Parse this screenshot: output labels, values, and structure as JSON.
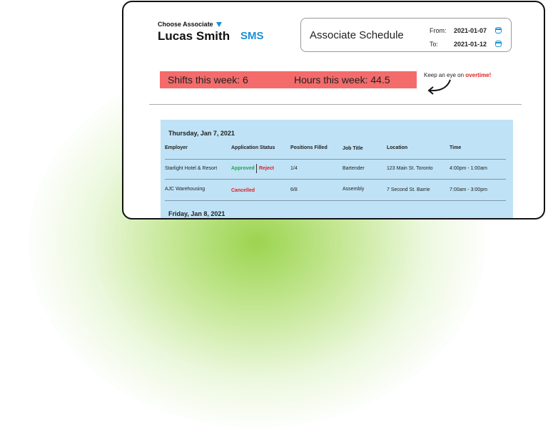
{
  "header": {
    "choose_label": "Choose Associate",
    "associate_name": "Lucas Smith",
    "brand": "SMS"
  },
  "schedule": {
    "title": "Associate Schedule",
    "from_label": "From:",
    "from_value": "2021-01-07",
    "to_label": "To:",
    "to_value": "2021-01-12"
  },
  "stats": {
    "shifts": "Shifts this week: 6",
    "hours": "Hours this week: 44.5"
  },
  "hint": {
    "prefix": "Keep an eye on ",
    "highlight": "overtime",
    "suffix": "!"
  },
  "table": {
    "columns": [
      "Employer",
      "Application Status",
      "Positions Filled",
      "Job Title",
      "Location",
      "Time"
    ],
    "days": [
      {
        "label": "Thursday, Jan 7, 2021",
        "rows": [
          {
            "employer": "Starlight Hotel & Resort",
            "status": "Approved",
            "action": "Reject",
            "positions": "1/4",
            "job": "Bartender",
            "location": "123 Main St. Toronto",
            "time": "4:00pm - 1:00am"
          },
          {
            "employer": "AJC Warehousing",
            "status": "Cancelled",
            "action": "",
            "positions": "6/8",
            "job": "Assembly",
            "location": "7 Second St. Barrie",
            "time": "7:00am - 3:00pm"
          }
        ]
      },
      {
        "label": "Friday, Jan 8, 2021",
        "rows": []
      }
    ]
  },
  "colors": {
    "accent": "#1a8fd6",
    "stats_bg": "#f46b6b",
    "panel_bg": "#bfe2f6",
    "approved": "#1aa84a",
    "alert": "#e02020",
    "glow": "#a5d65a"
  }
}
